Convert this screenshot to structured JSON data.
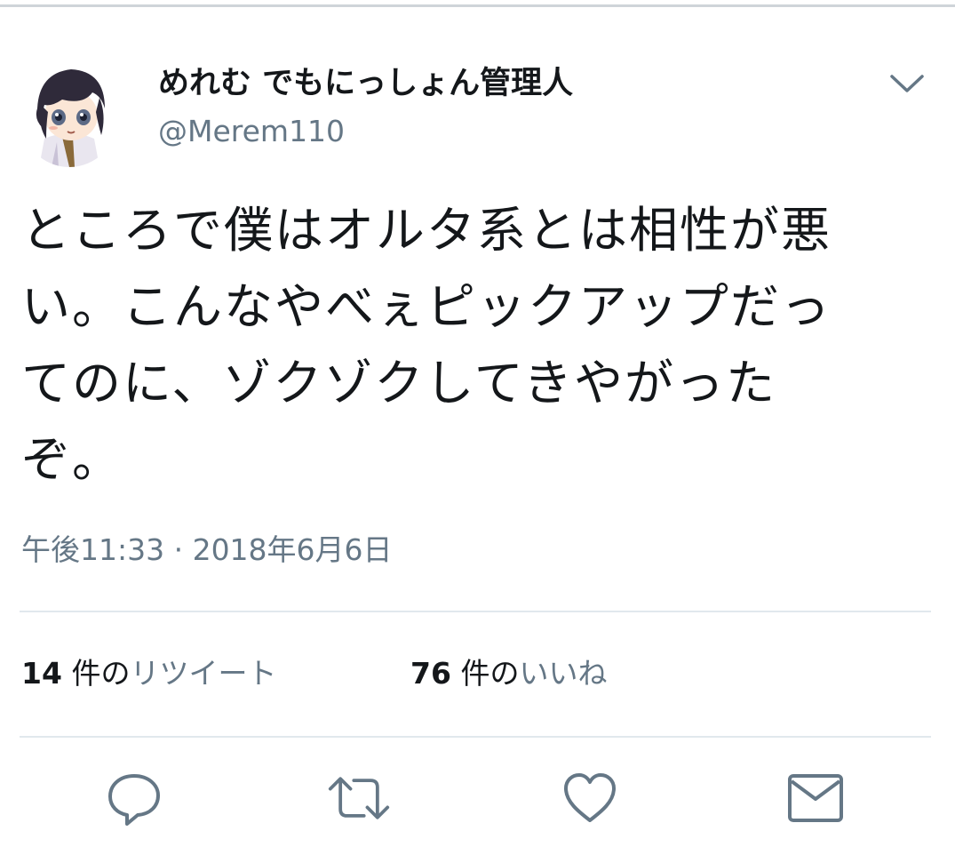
{
  "tweet": {
    "author": {
      "display_name": "めれむ でもにっしょん管理人",
      "handle": "@Merem110"
    },
    "text": "ところで僕はオルタ系とは相性が悪\nい。こんなやべぇピックアップだっ\nてのに、ゾクゾクしてきやがった\nぞ。",
    "timestamp": "午後11:33 · 2018年6月6日",
    "stats": {
      "retweets": {
        "count": "14",
        "unit": "件の",
        "label": "リツイート"
      },
      "likes": {
        "count": "76",
        "unit": "件の",
        "label": "いいね"
      }
    }
  },
  "colors": {
    "text_primary": "#14171a",
    "text_secondary": "#657786",
    "divider": "#e1e8ed",
    "icon": "#657786"
  },
  "icons": {
    "menu": "chevron-down-icon",
    "reply": "reply-icon",
    "retweet": "retweet-icon",
    "like": "heart-icon",
    "share": "envelope-icon"
  }
}
